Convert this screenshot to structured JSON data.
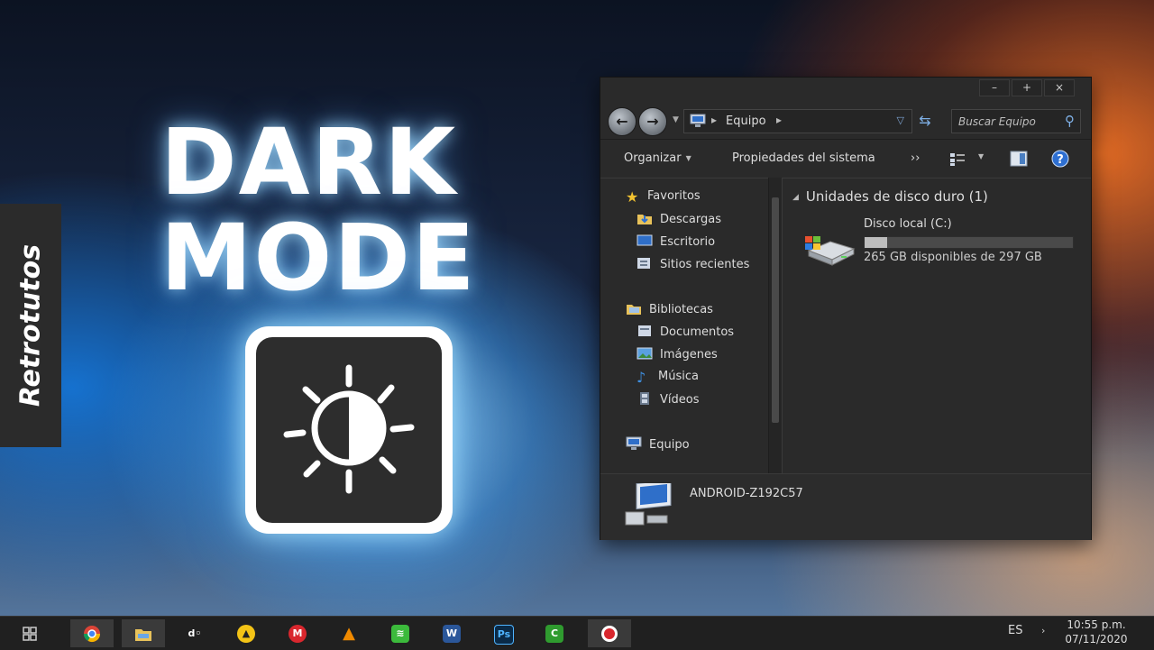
{
  "thumbnail": {
    "title_line1": "DARK",
    "title_line2": "MODE",
    "brand": "Retrotutos",
    "icon": "brightness-contrast-icon"
  },
  "explorer": {
    "controls": [
      "–",
      "+",
      "×"
    ],
    "address": {
      "breadcrumb": "Equipo"
    },
    "search": {
      "placeholder": "Buscar Equipo"
    },
    "commands": {
      "organize": "Organizar",
      "system_properties": "Propiedades del sistema",
      "more": "››"
    },
    "nav": {
      "favorites": "Favoritos",
      "downloads": "Descargas",
      "desktop": "Escritorio",
      "recent": "Sitios recientes",
      "libraries": "Bibliotecas",
      "documents": "Documentos",
      "images": "Imágenes",
      "music": "Música",
      "videos": "Vídeos",
      "computer": "Equipo"
    },
    "group": {
      "title": "Unidades de disco duro (1)"
    },
    "drive": {
      "name": "Disco local (C:)",
      "free_text": "265 GB disponibles de 297 GB",
      "used_fraction": 0.108
    },
    "details": {
      "computer_name": "ANDROID-Z192C57"
    }
  },
  "taskbar": {
    "apps": [
      "start-icon",
      "chrome-icon",
      "file-explorer-icon",
      "dl-icon",
      "app-yellow-icon",
      "mega-icon",
      "vlc-icon",
      "wifi-app-icon",
      "word-icon",
      "photoshop-icon",
      "camtasia-icon",
      "record-icon"
    ],
    "language": "ES",
    "time": "10:55 p.m.",
    "date": "07/11/2020"
  },
  "colors": {
    "window_bg": "#2a2a2a",
    "accent_blue": "#7fb0e6",
    "taskbar_bg": "#202020"
  }
}
